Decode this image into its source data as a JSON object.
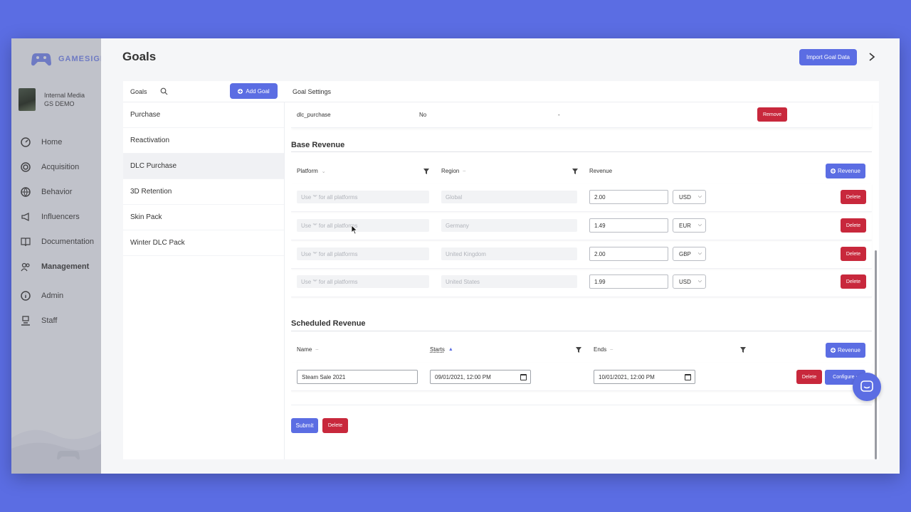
{
  "app": {
    "brand": "GAMESIGHT"
  },
  "org": {
    "line1": "Internal Media",
    "line2": "GS DEMO"
  },
  "nav": [
    {
      "label": "Home",
      "icon": "dashboard-icon"
    },
    {
      "label": "Acquisition",
      "icon": "target-icon"
    },
    {
      "label": "Behavior",
      "icon": "globe-icon"
    },
    {
      "label": "Influencers",
      "icon": "megaphone-icon"
    },
    {
      "label": "Documentation",
      "icon": "book-icon"
    },
    {
      "label": "Management",
      "icon": "users-icon"
    },
    {
      "label": "Admin",
      "icon": "info-icon"
    },
    {
      "label": "Staff",
      "icon": "badge-icon"
    }
  ],
  "header": {
    "title": "Goals",
    "import_label": "Import Goal Data"
  },
  "goals_panel": {
    "label": "Goals",
    "add_label": "Add Goal",
    "settings_label": "Goal Settings",
    "items": [
      "Purchase",
      "Reactivation",
      "DLC Purchase",
      "3D Retention",
      "Skin Pack",
      "Winter DLC Pack"
    ],
    "selected": "DLC Purchase"
  },
  "event": {
    "name": "dlc_purchase",
    "flag": "No",
    "dash": "-",
    "remove_label": "Remove"
  },
  "base_revenue": {
    "title": "Base Revenue",
    "columns": {
      "platform": "Platform",
      "region": "Region",
      "revenue": "Revenue"
    },
    "add_label": "Revenue",
    "rows": [
      {
        "platform_placeholder": "Use '*' for all platforms",
        "region": "Global",
        "revenue": "2.00",
        "currency": "USD",
        "delete_label": "Delete"
      },
      {
        "platform_placeholder": "Use '*' for all platforms",
        "region": "Germany",
        "revenue": "1.49",
        "currency": "EUR",
        "delete_label": "Delete"
      },
      {
        "platform_placeholder": "Use '*' for all platforms",
        "region": "United Kingdom",
        "revenue": "2.00",
        "currency": "GBP",
        "delete_label": "Delete"
      },
      {
        "platform_placeholder": "Use '*' for all platforms",
        "region": "United States",
        "revenue": "1.99",
        "currency": "USD",
        "delete_label": "Delete"
      }
    ]
  },
  "scheduled_revenue": {
    "title": "Scheduled Revenue",
    "columns": {
      "name": "Name",
      "starts": "Starts",
      "ends": "Ends"
    },
    "add_label": "Revenue",
    "rows": [
      {
        "name": "Steam Sale 2021",
        "starts": "09/01/2021, 12:00 PM",
        "ends": "10/01/2021, 12:00 PM",
        "delete_label": "Delete",
        "configure_label": "Configure ›"
      }
    ]
  },
  "footer": {
    "submit_label": "Submit",
    "delete_label": "Delete"
  },
  "colors": {
    "primary": "#5b6de3",
    "danger": "#c8283c"
  }
}
